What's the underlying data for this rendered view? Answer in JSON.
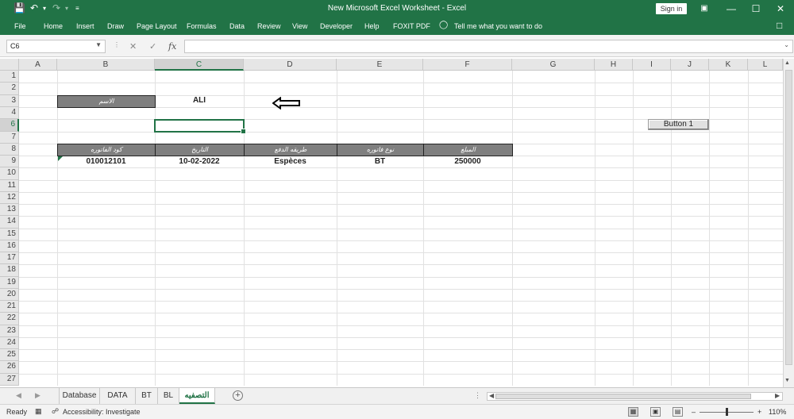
{
  "app": {
    "window_title": "New Microsoft Excel Worksheet  -  Excel",
    "sign_in": "Sign in",
    "accent": "#217346"
  },
  "quick_access": {
    "save_icon": "save-icon",
    "undo_icon": "undo-icon",
    "redo_icon": "redo-icon",
    "customize_icon": "customize-icon"
  },
  "ribbon": {
    "tabs": [
      "File",
      "Home",
      "Insert",
      "Draw",
      "Page Layout",
      "Formulas",
      "Data",
      "Review",
      "View",
      "Developer",
      "Help",
      "FOXIT PDF"
    ],
    "tell_me": "Tell me what you want to do"
  },
  "formula_bar": {
    "name_box": "C6",
    "fx": "fx",
    "formula": ""
  },
  "columns": [
    "A",
    "B",
    "C",
    "D",
    "E",
    "F",
    "G",
    "H",
    "I",
    "J",
    "K",
    "L"
  ],
  "rows": [
    "1",
    "2",
    "3",
    "4",
    "6",
    "7",
    "8",
    "9",
    "10",
    "11",
    "12",
    "13",
    "14",
    "15",
    "16",
    "17",
    "18",
    "19",
    "20",
    "21",
    "22",
    "23",
    "24",
    "25",
    "26",
    "27"
  ],
  "selection": {
    "active_cell": "C6",
    "active_column": "C",
    "active_row": "6"
  },
  "cells": {
    "b3_label": "الاسم",
    "c3_value": "ALI",
    "headers": [
      "كود الفاتوره",
      "التاريخ",
      "طريقه الدفع",
      "نوع فاتوره",
      "المبلغ"
    ],
    "values": [
      "010012101",
      "10-02-2022",
      "Espèces",
      "BT",
      "250000"
    ]
  },
  "form_button": "Button 1",
  "sheets": {
    "tabs": [
      "Database",
      "DATA",
      "BT",
      "BL",
      "التصفيه"
    ],
    "active": "التصفيه"
  },
  "status": {
    "ready": "Ready",
    "accessibility": "Accessibility: Investigate",
    "zoom": "110%"
  }
}
